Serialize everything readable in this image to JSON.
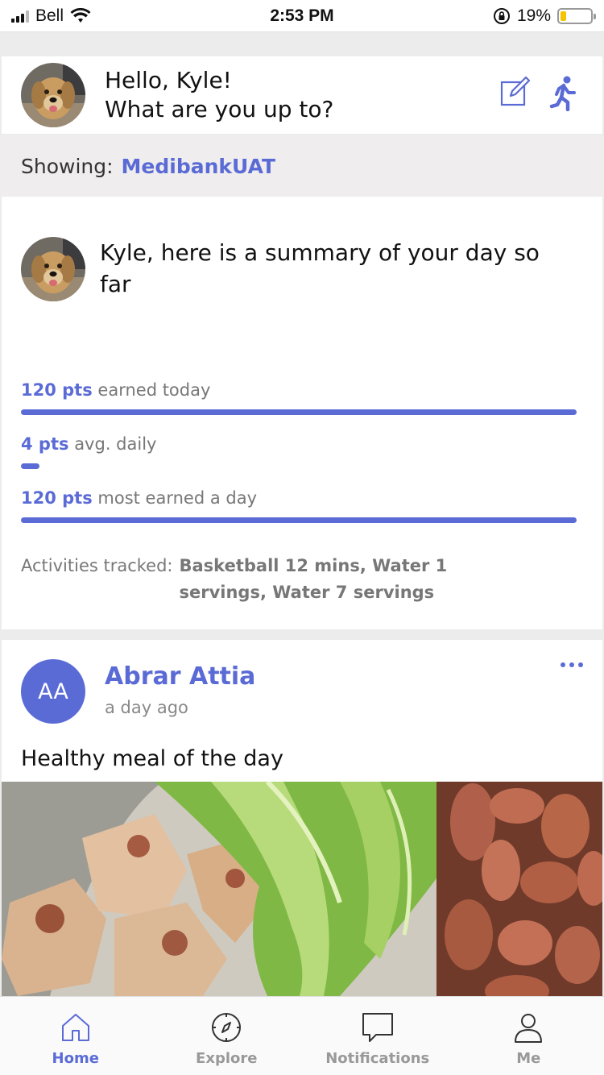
{
  "status_bar": {
    "carrier": "Bell",
    "time": "2:53 PM",
    "battery_percent": "19%",
    "battery_level": 0.19,
    "battery_color": "#f5c400"
  },
  "greeting": {
    "hello": "Hello, Kyle!",
    "prompt": "What are you up to?",
    "icons": [
      "compose-icon",
      "running-person-icon"
    ]
  },
  "showing": {
    "label": "Showing:",
    "org": "MedibankUAT"
  },
  "summary": {
    "title": "Kyle, here is a summary of your day so far",
    "stats": [
      {
        "pts": "120 pts",
        "desc": "earned today",
        "fraction": 1.0
      },
      {
        "pts": "4 pts",
        "desc": "avg. daily",
        "fraction": 0.033
      },
      {
        "pts": "120 pts",
        "desc": "most earned a day",
        "fraction": 1.0
      }
    ],
    "activities_label": "Activities tracked:",
    "activities_value": "Basketball 12 mins, Water 1 servings, Water 7 servings"
  },
  "post": {
    "initials": "AA",
    "author": "Abrar Attia",
    "time": "a day ago",
    "text": "Healthy meal of the day"
  },
  "tabs": [
    {
      "label": "Home",
      "icon": "home-icon",
      "active": true
    },
    {
      "label": "Explore",
      "icon": "compass-icon",
      "active": false
    },
    {
      "label": "Notifications",
      "icon": "chat-bubble-icon",
      "active": false
    },
    {
      "label": "Me",
      "icon": "person-icon",
      "active": false
    }
  ],
  "colors": {
    "accent": "#5b6bd6",
    "background": "#ececec"
  }
}
